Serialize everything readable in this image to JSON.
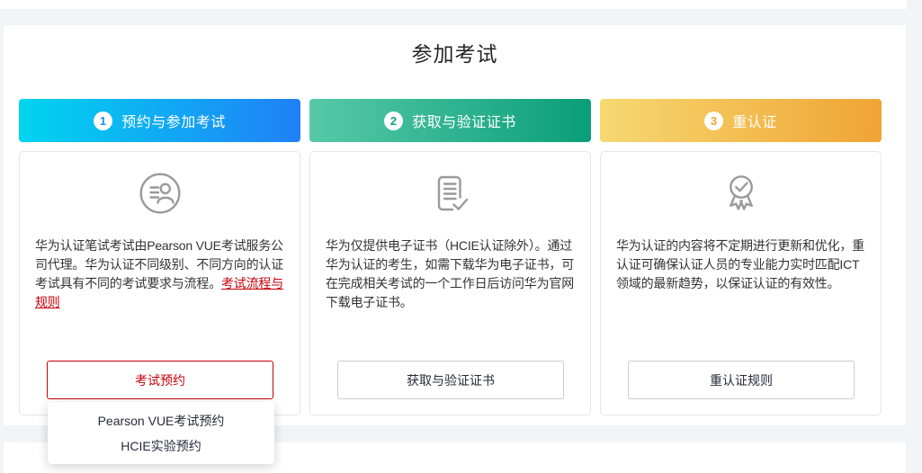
{
  "section": {
    "title": "参加考试"
  },
  "steps": [
    {
      "number": "1",
      "title": "预约与参加考试",
      "icon": "contact-profile-icon",
      "accent": {
        "gradient_start": "#00d5ef",
        "gradient_end": "#2080f7",
        "number_color": "#1b8df3"
      },
      "description": "华为认证笔试考试由Pearson VUE考试服务公司代理。华为认证不同级别、不同方向的认证考试具有不同的考试要求与流程。",
      "link_text": "考试流程与规则",
      "button_label": "考试预约"
    },
    {
      "number": "2",
      "title": "获取与验证证书",
      "icon": "document-check-icon",
      "accent": {
        "gradient_start": "#57c9a7",
        "gradient_end": "#0a9e79",
        "number_color": "#12a183"
      },
      "description": "华为仅提供电子证书（HCIE认证除外）。通过华为认证的考生，如需下载华为电子证书，可在完成相关考试的一个工作日后访问华为官网下载电子证书。",
      "button_label": "获取与验证证书"
    },
    {
      "number": "3",
      "title": "重认证",
      "icon": "medal-check-icon",
      "accent": {
        "gradient_start": "#f6d871",
        "gradient_end": "#f0a435",
        "number_color": "#f0a435"
      },
      "description": "华为认证的内容将不定期进行更新和优化，重认证可确保认证人员的专业能力实时匹配ICT领域的最新趋势，以保证认证的有效性。",
      "button_label": "重认证规则"
    }
  ],
  "dropdown": {
    "items": [
      {
        "label": "Pearson VUE考试预约"
      },
      {
        "label": "HCIE实验预约"
      }
    ]
  },
  "colors": {
    "page_background": "#f2f4f7",
    "card_border": "#e6e6e6",
    "link_red": "#c7000b",
    "danger_button_border": "#c7000b",
    "text_primary": "#333333",
    "step1_gradient": [
      "#00d5ef",
      "#2080f7"
    ],
    "step2_gradient": [
      "#57c9a7",
      "#0a9e79"
    ],
    "step3_gradient": [
      "#f6d871",
      "#f0a435"
    ]
  }
}
